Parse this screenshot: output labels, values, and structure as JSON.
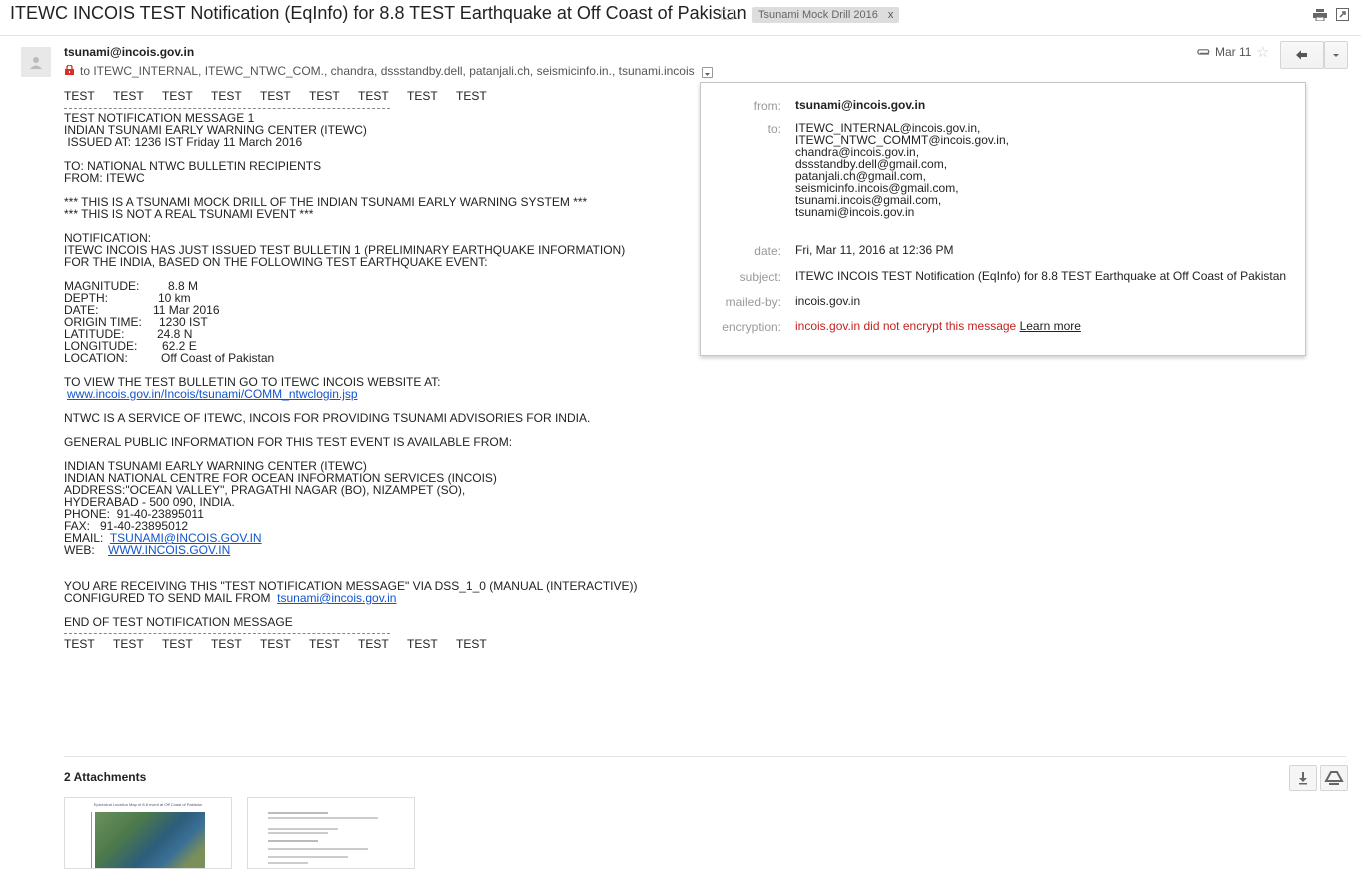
{
  "header": {
    "subject": "ITEWC INCOIS TEST Notification (EqInfo) for 8.8 TEST Earthquake at Off Coast of Pakistan",
    "label": "Tsunami Mock Drill 2016",
    "label_remove": "x",
    "icons": [
      "print-icon",
      "new-window-icon"
    ]
  },
  "message": {
    "sender": "tsunami@incois.gov.in",
    "recipients": "to ITEWC_INTERNAL, ITEWC_NTWC_COM., chandra, dssstandby.dell, patanjali.ch, seismicinfo.in., tsunami.incois",
    "date_short": "Mar 11",
    "icons": [
      "lock-icon",
      "paperclip-icon",
      "star-icon",
      "reply-icon",
      "more-icon"
    ]
  },
  "details": {
    "from_label": "from:",
    "from": "tsunami@incois.gov.in",
    "to_label": "to:",
    "to": [
      "ITEWC_INTERNAL@incois.gov.in,",
      "ITEWC_NTWC_COMMT@incois.gov.in,",
      "chandra@incois.gov.in,",
      "dssstandby.dell@gmail.com,",
      "patanjali.ch@gmail.com,",
      "seismicinfo.incois@gmail.com,",
      "tsunami.incois@gmail.com,",
      "tsunami@incois.gov.in"
    ],
    "date_label": "date:",
    "date": "Fri, Mar 11, 2016 at 12:36 PM",
    "subject_label": "subject:",
    "subject": "ITEWC INCOIS TEST Notification (EqInfo) for 8.8 TEST Earthquake at Off Coast of Pakistan",
    "mailedby_label": "mailed-by:",
    "mailedby": "incois.gov.in",
    "encryption_label": "encryption:",
    "encryption": "incois.gov.in did not encrypt this message",
    "learn_more": "Learn more"
  },
  "body": {
    "test_word": "TEST",
    "intro": [
      "TEST NOTIFICATION MESSAGE 1",
      "INDIAN TSUNAMI EARLY WARNING CENTER (ITEWC)",
      " ISSUED AT: 1236 IST Friday 11 March 2016"
    ],
    "to_from": [
      "TO: NATIONAL NTWC BULLETIN RECIPIENTS",
      "FROM: ITEWC"
    ],
    "drill": [
      "*** THIS IS A TSUNAMI MOCK DRILL OF THE INDIAN TSUNAMI EARLY WARNING SYSTEM ***",
      "*** THIS IS NOT A REAL TSUNAMI EVENT ***"
    ],
    "notification": [
      "NOTIFICATION:",
      "ITEWC INCOIS HAS JUST ISSUED TEST BULLETIN 1 (PRELIMINARY EARTHQUAKE INFORMATION)",
      "FOR THE INDIA, BASED ON THE FOLLOWING TEST EARTHQUAKE EVENT:"
    ],
    "event": [
      {
        "k": "MAGNITUDE:",
        "v": "8.8 M"
      },
      {
        "k": "DEPTH:",
        "v": "10  km"
      },
      {
        "k": "DATE:",
        "v": "11 Mar 2016"
      },
      {
        "k": "ORIGIN TIME:",
        "v": "1230 IST"
      },
      {
        "k": "LATITUDE:",
        "v": "24.8 N"
      },
      {
        "k": "LONGITUDE:",
        "v": "62.2 E"
      },
      {
        "k": "LOCATION:",
        "v": "Off Coast of Pakistan"
      }
    ],
    "view_line": "TO VIEW THE TEST BULLETIN GO TO ITEWC INCOIS WEBSITE AT:",
    "view_link": "www.incois.gov.in/Incois/tsunami/COMM_ntwclogin.jsp",
    "service_line": "NTWC IS A SERVICE OF ITEWC, INCOIS FOR PROVIDING TSUNAMI ADVISORIES FOR INDIA.",
    "public_line": "GENERAL PUBLIC INFORMATION FOR THIS TEST EVENT IS AVAILABLE FROM:",
    "address": [
      "INDIAN TSUNAMI EARLY WARNING CENTER (ITEWC)",
      "INDIAN NATIONAL CENTRE FOR OCEAN INFORMATION SERVICES (INCOIS)",
      "ADDRESS:\"OCEAN VALLEY\", PRAGATHI NAGAR (BO), NIZAMPET (SO),",
      "HYDERABAD - 500 090, INDIA.",
      "PHONE:  91-40-23895011",
      "FAX:   91-40-23895012"
    ],
    "email_label": "EMAIL:",
    "email": "TSUNAMI@INCOIS.GOV.IN",
    "web_label": "WEB:",
    "web": "WWW.INCOIS.GOV.IN",
    "receiving_line": "YOU ARE RECEIVING THIS \"TEST NOTIFICATION MESSAGE\" VIA DSS_1_0 (MANUAL (INTERACTIVE))",
    "configured_label": "CONFIGURED TO SEND MAIL FROM",
    "configured_link": "tsunami@incois.gov.in",
    "end_line": "END OF TEST NOTIFICATION MESSAGE"
  },
  "attachments": {
    "title": "2 Attachments",
    "icons": [
      "download-icon",
      "drive-icon"
    ],
    "thumb1_title": "Epicentral Location Map of 8.8 event at Off Coast of Pakistan"
  }
}
